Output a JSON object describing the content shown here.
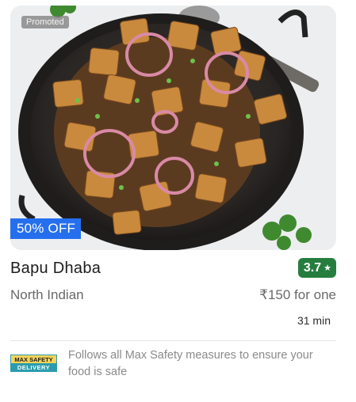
{
  "card": {
    "promoted_label": "Promoted",
    "offer_label": "50% OFF",
    "restaurant_name": "Bapu Dhaba",
    "rating": "3.7",
    "cuisine": "North Indian",
    "price_for_one": "₹150 for one",
    "delivery_time": "31 min",
    "safety_badge": {
      "top": "MAX SAFETY",
      "bottom": "DELIVERY"
    },
    "safety_text": "Follows all Max Safety measures to ensure your food is safe"
  },
  "colors": {
    "offer_bg": "#256fef",
    "rating_bg": "#267e3e",
    "badge_yellow": "#f4d35a",
    "badge_teal": "#2b9cad"
  },
  "icons": {
    "rating_star": "star-icon"
  }
}
